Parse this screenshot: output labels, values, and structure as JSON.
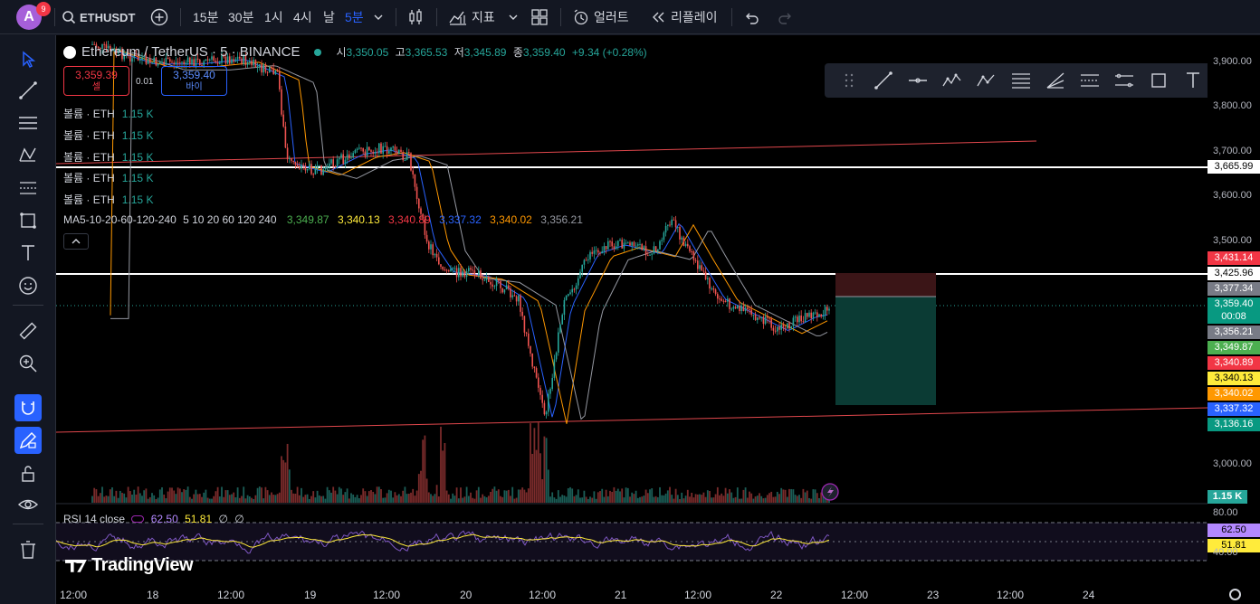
{
  "header": {
    "avatar_letter": "A",
    "notification_count": "9",
    "symbol": "ETHUSDT",
    "intervals": [
      "15분",
      "30분",
      "1시",
      "4시",
      "날",
      "5분"
    ],
    "active_interval": "5분",
    "indicators_label": "지표",
    "alert_label": "얼러트",
    "replay_label": "리플레이"
  },
  "legend": {
    "title": "Ethereum / TetherUS · 5 · BINANCE",
    "open_label": "시",
    "open": "3,350.05",
    "high_label": "고",
    "high": "3,365.53",
    "low_label": "저",
    "low": "3,345.89",
    "close_label": "종",
    "close": "3,359.40",
    "change": "+9.34 (+0.28%)",
    "sell_price": "3,359.39",
    "sell_label": "셀",
    "buy_price": "3,359.40",
    "buy_label": "바이",
    "spread": "0.01",
    "volume_rows": [
      {
        "label": "볼륨 · ETH",
        "value": "1.15 K"
      },
      {
        "label": "볼륨 · ETH",
        "value": "1.15 K"
      },
      {
        "label": "볼륨 · ETH",
        "value": "1.15 K"
      },
      {
        "label": "볼륨 · ETH",
        "value": "1.15 K"
      },
      {
        "label": "볼륨 · ETH",
        "value": "1.15 K"
      }
    ],
    "ma_name": "MA5-10-20-60-120-240",
    "ma_params": "5 10 20 60 120 240",
    "ma_values": [
      {
        "value": "3,349.87",
        "color": "#4caf50"
      },
      {
        "value": "3,340.13",
        "color": "#ffeb3b"
      },
      {
        "value": "3,340.89",
        "color": "#f23645"
      },
      {
        "value": "3,337.32",
        "color": "#2962ff"
      },
      {
        "value": "3,340.02",
        "color": "#ff9800"
      },
      {
        "value": "3,356.21",
        "color": "#9598a1"
      }
    ]
  },
  "rsi": {
    "name": "RSI 14 close",
    "value1": "62.50",
    "value2": "51.81",
    "flag1": "∅",
    "flag2": "∅"
  },
  "brand": "TradingView",
  "price_scale": {
    "ticks": [
      "3,900.00",
      "3,800.00",
      "3,700.00",
      "3,600.00",
      "3,500.00",
      "3,000.00"
    ],
    "labels": [
      {
        "text": "3,665.99",
        "bg": "#ffffff",
        "fg": "#000000"
      },
      {
        "text": "3,431.14",
        "bg": "#f23645",
        "fg": "#ffffff"
      },
      {
        "text": "3,425.96",
        "bg": "#ffffff",
        "fg": "#000000"
      },
      {
        "text": "3,377.34",
        "bg": "#787b86",
        "fg": "#ffffff"
      },
      {
        "text": "3,359.40",
        "bg": "#089981",
        "fg": "#ffffff"
      },
      {
        "text": "00:08",
        "bg": "#089981",
        "fg": "#ffffff"
      },
      {
        "text": "3,356.21",
        "bg": "#787b86",
        "fg": "#ffffff"
      },
      {
        "text": "3,349.87",
        "bg": "#4caf50",
        "fg": "#ffffff"
      },
      {
        "text": "3,340.89",
        "bg": "#f23645",
        "fg": "#ffffff"
      },
      {
        "text": "3,340.13",
        "bg": "#ffeb3b",
        "fg": "#000000"
      },
      {
        "text": "3,340.02",
        "bg": "#ff9800",
        "fg": "#ffffff"
      },
      {
        "text": "3,337.32",
        "bg": "#2962ff",
        "fg": "#ffffff"
      },
      {
        "text": "3,136.16",
        "bg": "#089981",
        "fg": "#ffffff"
      }
    ],
    "volume_label": "1.15 K",
    "rsi_ticks": [
      "80.00",
      "40.00"
    ],
    "rsi_label1": "62.50",
    "rsi_label2": "51.81"
  },
  "time_scale": [
    "12:00",
    "18",
    "12:00",
    "19",
    "12:00",
    "20",
    "12:00",
    "21",
    "12:00",
    "22",
    "12:00",
    "23",
    "12:00",
    "24"
  ]
}
